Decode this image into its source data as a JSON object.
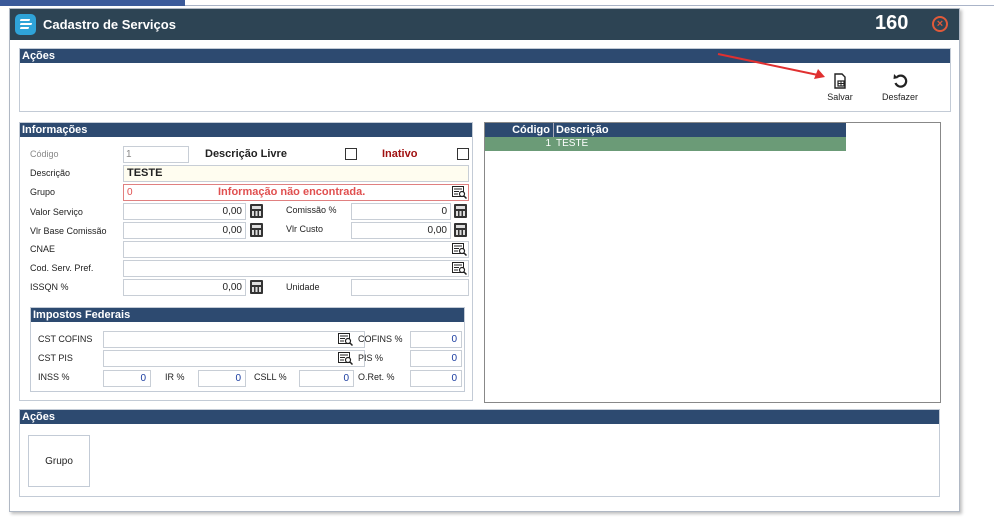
{
  "window": {
    "title": "Cadastro de Serviços",
    "code": "160",
    "close_icon": "close-circle-icon"
  },
  "acoes_top": {
    "header": "Ações",
    "save_label": "Salvar",
    "undo_label": "Desfazer",
    "save_icon": "save-document-icon",
    "undo_icon": "undo-arrow-icon"
  },
  "info": {
    "header": "Informações",
    "codigo_label": "Código",
    "codigo_value": "1",
    "descricao_livre_label": "Descrição Livre",
    "inativo_label": "Inativo",
    "descricao_label": "Descrição",
    "descricao_value": "TESTE",
    "grupo_label": "Grupo",
    "grupo_value": "0",
    "grupo_message": "Informação não encontrada.",
    "valor_servico_label": "Valor Serviço",
    "valor_servico_value": "0,00",
    "comissao_label": "Comissão %",
    "comissao_value": "0",
    "vlr_base_label": "Vlr Base Comissão",
    "vlr_base_value": "0,00",
    "vlr_custo_label": "Vlr Custo",
    "vlr_custo_value": "0,00",
    "cnae_label": "CNAE",
    "cod_serv_label": "Cod. Serv. Pref.",
    "issqn_label": "ISSQN %",
    "issqn_value": "0,00",
    "unidade_label": "Unidade"
  },
  "impostos": {
    "header": "Impostos Federais",
    "cst_cofins_label": "CST COFINS",
    "cofins_label": "COFINS %",
    "cofins_value": "0",
    "cst_pis_label": "CST PIS",
    "pis_label": "PIS %",
    "pis_value": "0",
    "inss_label": "INSS %",
    "inss_value": "0",
    "ir_label": "IR %",
    "ir_value": "0",
    "csll_label": "CSLL %",
    "csll_value": "0",
    "oret_label": "O.Ret. %",
    "oret_value": "0"
  },
  "grid": {
    "headers": [
      "Código",
      "Descrição"
    ],
    "rows": [
      {
        "codigo": "1",
        "descricao": "TESTE"
      }
    ]
  },
  "acoes_bottom": {
    "header": "Ações",
    "grupo_button": "Grupo"
  },
  "colors": {
    "titlebar": "#2d4454",
    "panel_header": "#2d4a70",
    "selected_row": "#6b9b77",
    "accent_red": "#e03030"
  }
}
